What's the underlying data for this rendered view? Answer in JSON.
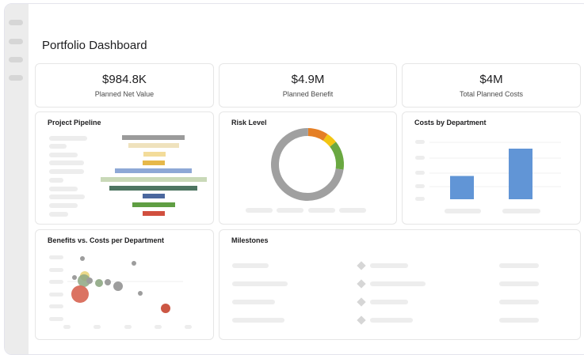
{
  "header": {
    "title": "Portfolio Dashboard"
  },
  "kpis": [
    {
      "value": "$984.8K",
      "label": "Planned Net Value"
    },
    {
      "value": "$4.9M",
      "label": "Planned Benefit"
    },
    {
      "value": "$4M",
      "label": "Total Planned Costs"
    }
  ],
  "pipeline": {
    "title": "Project Pipeline",
    "colors": [
      "#9b9b9b",
      "#efe2bd",
      "#f3dc9a",
      "#e6b84a",
      "#8ea8d6",
      "#c9d9b8",
      "#4d7561",
      "#4b679e",
      "#5f9e43",
      "#d14f3f"
    ]
  },
  "risk": {
    "title": "Risk Level",
    "segments": [
      {
        "color": "#e57f25",
        "fraction": 0.09
      },
      {
        "color": "#f2c512",
        "fraction": 0.05
      },
      {
        "color": "#6aa841",
        "fraction": 0.13
      },
      {
        "color": "#a0a0a0",
        "fraction": 0.73
      }
    ]
  },
  "costs": {
    "title": "Costs by Department",
    "bar_color": "#6195d6",
    "values": [
      0.46,
      1.0
    ]
  },
  "benefits": {
    "title": "Benefits vs. Costs per Department",
    "bubble_colors": [
      "#9d9d9d",
      "#e8d276",
      "#8ea783",
      "#d96c5a",
      "#cc5744"
    ]
  },
  "milestones": {
    "title": "Milestones",
    "rows": 4
  }
}
